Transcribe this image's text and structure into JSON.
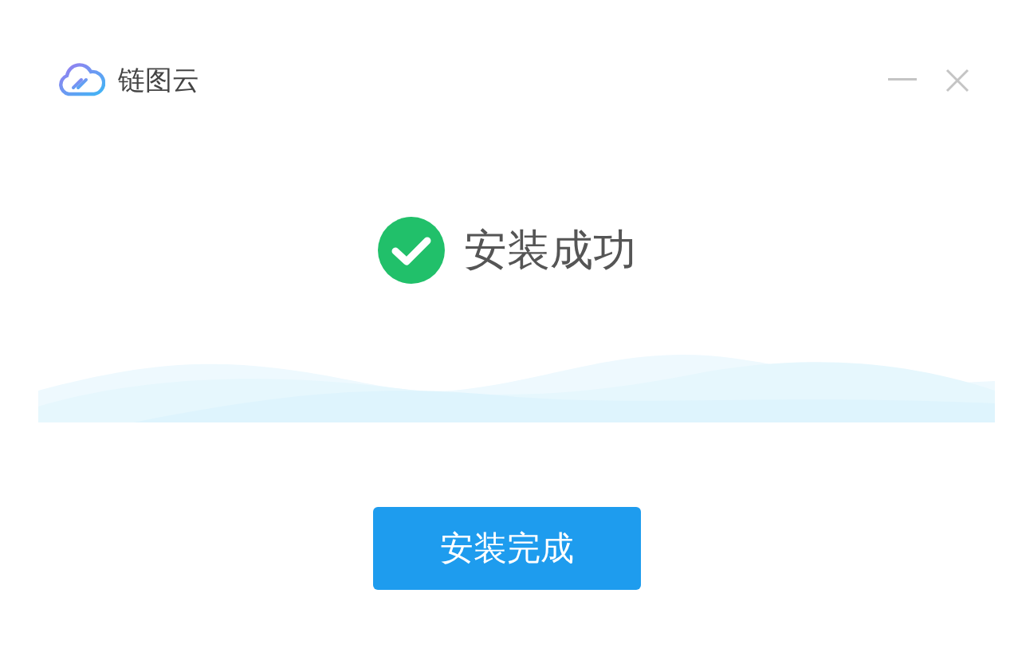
{
  "window": {
    "title": "链图云"
  },
  "status": {
    "kind": "success",
    "text": "安装成功"
  },
  "button": {
    "label": "安装完成"
  }
}
